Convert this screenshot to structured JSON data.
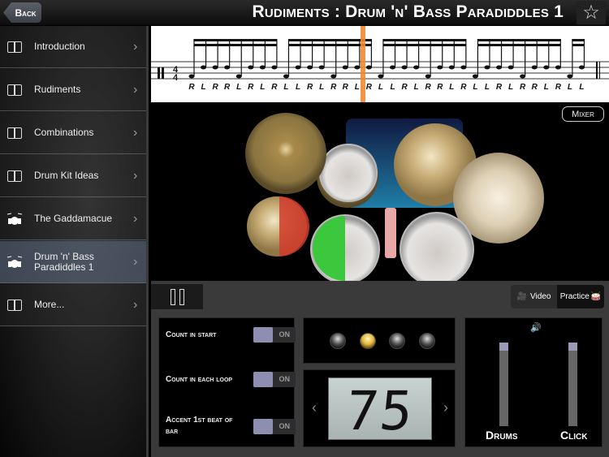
{
  "header": {
    "back_label": "Back",
    "title": "Rudiments : Drum 'n' Bass Paradiddles 1",
    "favorite_icon": "star-icon"
  },
  "sidebar": {
    "items": [
      {
        "label": "Introduction",
        "icon": "book-icon",
        "active": false
      },
      {
        "label": "Rudiments",
        "icon": "book-icon",
        "active": false
      },
      {
        "label": "Combinations",
        "icon": "book-icon",
        "active": false
      },
      {
        "label": "Drum Kit Ideas",
        "icon": "book-icon",
        "active": false
      },
      {
        "label": "The Gaddamacue",
        "icon": "drum-kit-icon",
        "active": false
      },
      {
        "label": "Drum 'n' Bass Paradiddles 1",
        "icon": "drum-kit-icon",
        "active": true
      },
      {
        "label": "More...",
        "icon": "book-icon",
        "active": false
      }
    ]
  },
  "notation": {
    "time_signature": "4/4",
    "sticking": [
      "R",
      "L",
      "R",
      "R",
      "L",
      "R",
      "L",
      "R",
      "L",
      "L",
      "R",
      "L",
      "R",
      "R",
      "L",
      "R",
      "L",
      "L",
      "R",
      "L",
      "R",
      "R",
      "L",
      "R",
      "L",
      "L",
      "R",
      "L",
      "R",
      "R",
      "L",
      "R",
      "L",
      "L"
    ],
    "playhead_color": "#f08a30"
  },
  "stage": {
    "mixer_label": "Mixer",
    "highlight_colors": {
      "hihat": "#d23c2c",
      "snare": "#3cc83c"
    }
  },
  "controls": {
    "video_label": "Video",
    "practice_label": "Practice",
    "options": [
      {
        "label": "Count in start",
        "state": "ON"
      },
      {
        "label": "Count in each loop",
        "state": "ON"
      },
      {
        "label": "Accent 1st beat of bar",
        "state": "ON"
      }
    ],
    "beat_leds": {
      "count": 4,
      "active_index": 1
    },
    "tempo": "75",
    "mixer": {
      "channels": [
        {
          "label": "Drums",
          "level_percent": 100
        },
        {
          "label": "Click",
          "level_percent": 100
        }
      ]
    }
  }
}
